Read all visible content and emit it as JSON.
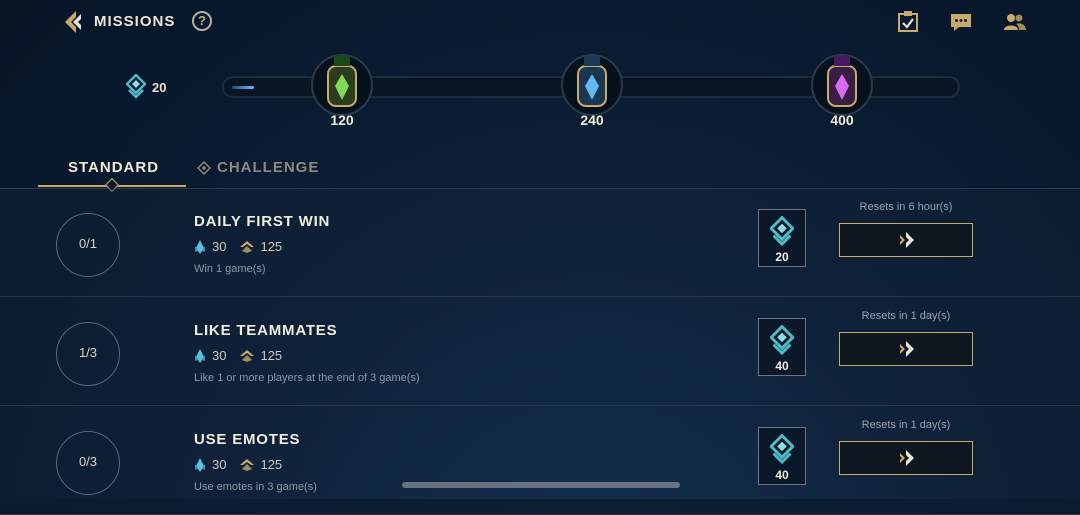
{
  "header": {
    "title": "MISSIONS",
    "help_label": "?"
  },
  "points": {
    "value": "20"
  },
  "progress": {
    "fraction": 0.03,
    "milestones": [
      {
        "value": "120",
        "color": "#7ed957"
      },
      {
        "value": "240",
        "color": "#62b8f0"
      },
      {
        "value": "400",
        "color": "#d86cf0"
      }
    ]
  },
  "tabs": [
    {
      "label": "STANDARD",
      "active": true
    },
    {
      "label": "CHALLENGE",
      "active": false
    }
  ],
  "missions": [
    {
      "progress": "0/1",
      "title": "DAILY FIRST WIN",
      "reward_a": "30",
      "reward_b": "125",
      "description": "Win 1 game(s)",
      "points": "20",
      "reset": "Resets in 6 hour(s)"
    },
    {
      "progress": "1/3",
      "title": "LIKE TEAMMATES",
      "reward_a": "30",
      "reward_b": "125",
      "description": "Like 1 or more players at the end of 3 game(s)",
      "points": "40",
      "reset": "Resets in 1 day(s)"
    },
    {
      "progress": "0/3",
      "title": "USE EMOTES",
      "reward_a": "30",
      "reward_b": "125",
      "description": "Use emotes in 3 game(s)",
      "points": "40",
      "reset": "Resets in 1 day(s)"
    }
  ],
  "colors": {
    "accent": "#c8aa6e",
    "teal": "#4fb9c8",
    "gold": "#c8aa6e"
  },
  "icons": [
    "back-arrow-icon",
    "help-icon",
    "checklist-icon",
    "chat-icon",
    "friends-icon",
    "mission-point-icon",
    "blue-essence-icon",
    "gold-icon",
    "go-arrow-icon",
    "challenge-icon"
  ]
}
